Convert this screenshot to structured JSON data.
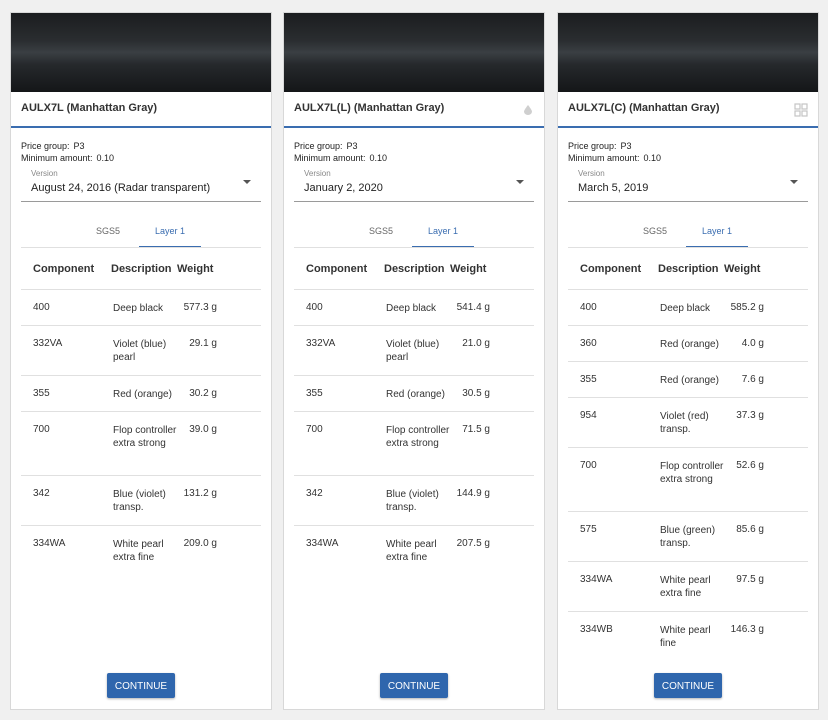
{
  "labels": {
    "price_group": "Price group:",
    "minimum_amount": "Minimum amount:",
    "version": "Version",
    "col_component": "Component",
    "col_description": "Description",
    "col_weight": "Weight",
    "continue": "CONTINUE"
  },
  "colors": {
    "accent": "#3a6db0",
    "button": "#2f66ad",
    "swatch": "#26292c"
  },
  "cards": [
    {
      "title": "AULX7L (Manhattan Gray)",
      "icon": "",
      "price_group": "P3",
      "minimum_amount": "0.10",
      "version": "August 24, 2016  (Radar transparent)",
      "tabs": [
        "SGS5",
        "Layer 1"
      ],
      "rows": [
        {
          "component": "400",
          "description": "Deep black",
          "weight": "577.3 g"
        },
        {
          "component": "332VA",
          "description": "Violet (blue) pearl",
          "weight": "29.1 g"
        },
        {
          "component": "355",
          "description": "Red (orange)",
          "weight": "30.2 g"
        },
        {
          "component": "700",
          "description": "Flop controller extra strong",
          "weight": "39.0 g"
        },
        {
          "component": "342",
          "description": "Blue (violet) transp.",
          "weight": "131.2 g"
        },
        {
          "component": "334WA",
          "description": "White pearl extra fine",
          "weight": "209.0 g"
        }
      ]
    },
    {
      "title": "AULX7L(L) (Manhattan Gray)",
      "icon": "drop-icon",
      "price_group": "P3",
      "minimum_amount": "0.10",
      "version": "January 2, 2020",
      "tabs": [
        "SGS5",
        "Layer 1"
      ],
      "rows": [
        {
          "component": "400",
          "description": "Deep black",
          "weight": "541.4 g"
        },
        {
          "component": "332VA",
          "description": "Violet (blue) pearl",
          "weight": "21.0 g"
        },
        {
          "component": "355",
          "description": "Red (orange)",
          "weight": "30.5 g"
        },
        {
          "component": "700",
          "description": "Flop controller extra strong",
          "weight": "71.5 g"
        },
        {
          "component": "342",
          "description": "Blue (violet) transp.",
          "weight": "144.9 g"
        },
        {
          "component": "334WA",
          "description": "White pearl extra fine",
          "weight": "207.5 g"
        }
      ]
    },
    {
      "title": "AULX7L(C) (Manhattan Gray)",
      "icon": "grid-icon",
      "price_group": "P3",
      "minimum_amount": "0.10",
      "version": "March 5, 2019",
      "tabs": [
        "SGS5",
        "Layer 1"
      ],
      "rows": [
        {
          "component": "400",
          "description": "Deep black",
          "weight": "585.2 g"
        },
        {
          "component": "360",
          "description": "Red (orange)",
          "weight": "4.0 g"
        },
        {
          "component": "355",
          "description": "Red (orange)",
          "weight": "7.6 g"
        },
        {
          "component": "954",
          "description": "Violet (red) transp.",
          "weight": "37.3 g"
        },
        {
          "component": "700",
          "description": "Flop controller extra strong",
          "weight": "52.6 g"
        },
        {
          "component": "575",
          "description": "Blue (green) transp.",
          "weight": "85.6 g"
        },
        {
          "component": "334WA",
          "description": "White pearl extra fine",
          "weight": "97.5 g"
        },
        {
          "component": "334WB",
          "description": "White pearl fine",
          "weight": "146.3 g"
        }
      ]
    }
  ]
}
